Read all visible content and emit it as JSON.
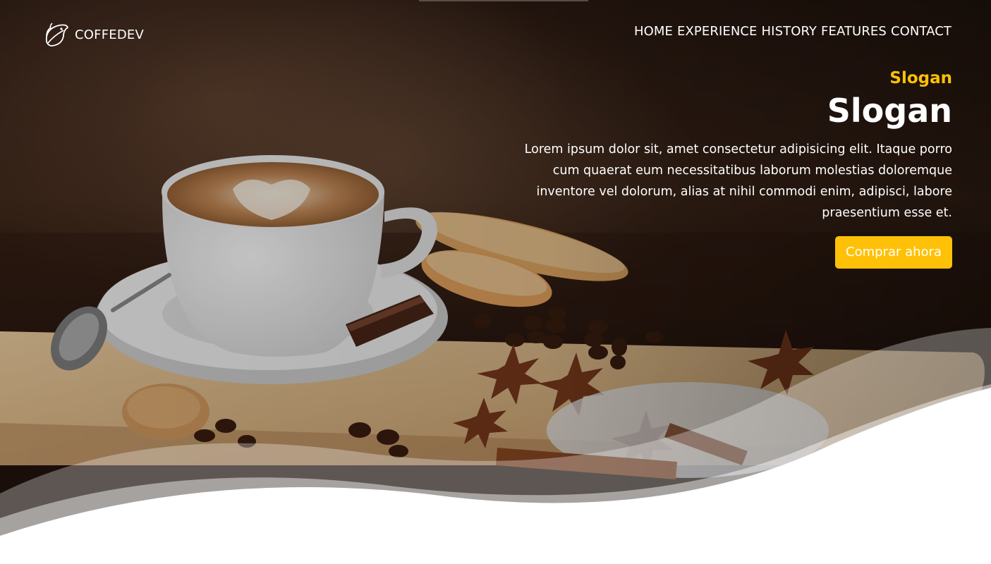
{
  "brand": {
    "name": "COFFEDEV",
    "logo_icon": "coffee-leaf-icon"
  },
  "nav": {
    "items": [
      {
        "label": "HOME"
      },
      {
        "label": "EXPERIENCE"
      },
      {
        "label": "HISTORY"
      },
      {
        "label": "FEATURES"
      },
      {
        "label": "CONTACT"
      }
    ]
  },
  "hero": {
    "eyebrow": "Slogan",
    "title": "Slogan",
    "description": "Lorem ipsum dolor sit, amet consectetur adipisicing elit. Itaque porro cum quaerat eum necessitatibus laborum molestias doloremque inventore vel dolorum, alias at nihil commodi enim, adipisci, labore praesentium esse et.",
    "cta_label": "Comprar ahora"
  },
  "colors": {
    "accent": "#ffc107",
    "text": "#ffffff",
    "background": "#ffffff"
  }
}
